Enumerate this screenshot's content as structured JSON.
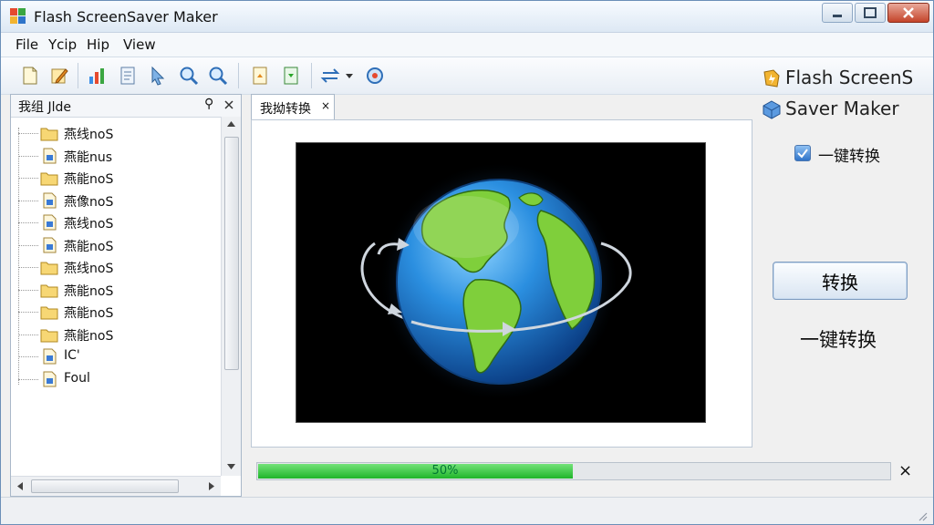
{
  "window": {
    "title": "Flash ScreenSaver Maker"
  },
  "menu": {
    "items": [
      "File",
      "Ycip",
      "Hip",
      "View"
    ]
  },
  "toolbar": {
    "icons": [
      "new-file-icon",
      "edit-icon",
      "chart-icon",
      "document-icon",
      "pointer-icon",
      "zoom-in-icon",
      "zoom-out-icon",
      "export-icon",
      "import-icon",
      "transfer-icon",
      "refresh-icon"
    ]
  },
  "sidebar": {
    "header": "我组 Jlde",
    "pin_glyph": "⚲",
    "items": [
      {
        "label": "燕线noS",
        "type": "folder"
      },
      {
        "label": "燕能nus",
        "type": "doc"
      },
      {
        "label": "燕能noS",
        "type": "folder"
      },
      {
        "label": "燕像noS",
        "type": "doc"
      },
      {
        "label": "燕线noS",
        "type": "doc"
      },
      {
        "label": "燕能noS",
        "type": "doc"
      },
      {
        "label": "燕线noS",
        "type": "folder"
      },
      {
        "label": "燕能noS",
        "type": "folder"
      },
      {
        "label": "燕能noS",
        "type": "folder"
      },
      {
        "label": "燕能noS",
        "type": "folder"
      },
      {
        "label": "IC'",
        "type": "doc"
      },
      {
        "label": "Foul",
        "type": "doc"
      }
    ]
  },
  "tab": {
    "label": "我拗转换",
    "close_glyph": "×"
  },
  "brand": {
    "line1": "Flash ScreenS",
    "line2": "Saver Maker"
  },
  "option": {
    "checkbox_label": "一键转换",
    "checked": true
  },
  "convert_button": {
    "label": "转换"
  },
  "oneclick_text": "一键转换",
  "progress": {
    "percent": 50,
    "text": "50%",
    "close_glyph": "×"
  },
  "colors": {
    "accent": "#2f74c9",
    "progress": "#1fb52a",
    "preview_bg": "#000000"
  }
}
